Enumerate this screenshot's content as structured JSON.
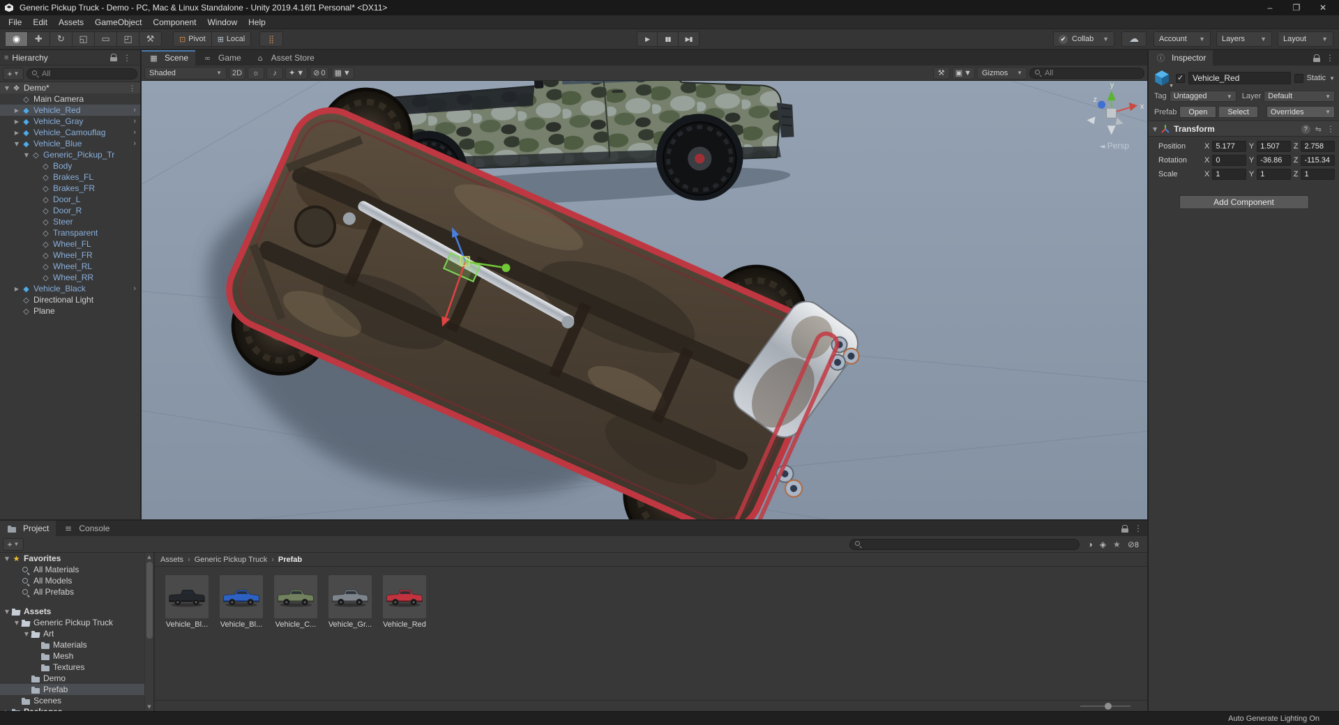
{
  "colors": {
    "prefab_text": "#8ab0dd",
    "prefab_icon": "#4dabea",
    "selection_row": "#4a4d52",
    "scene_background": "#8a98a8",
    "truck_red": "#c2333e",
    "star": "#f5c132",
    "active_tab_accent": "#4c7baf"
  },
  "title_bar": {
    "title": "Generic Pickup Truck - Demo - PC, Mac & Linux Standalone - Unity 2019.4.16f1 Personal* <DX11>",
    "minimize_glyph": "–",
    "maximize_glyph": "❐",
    "close_glyph": "✕"
  },
  "menu_bar": {
    "items": [
      {
        "label": "File"
      },
      {
        "label": "Edit"
      },
      {
        "label": "Assets"
      },
      {
        "label": "GameObject"
      },
      {
        "label": "Component"
      },
      {
        "label": "Window"
      },
      {
        "label": "Help"
      }
    ]
  },
  "toolbar": {
    "tools": [
      {
        "name": "hand-tool-button",
        "glyph": "◉",
        "cls": "active"
      },
      {
        "name": "move-tool-button",
        "glyph": "✚"
      },
      {
        "name": "rotate-tool-button",
        "glyph": "↻"
      },
      {
        "name": "scale-tool-button",
        "glyph": "◱"
      },
      {
        "name": "rect-tool-button",
        "glyph": "▭"
      },
      {
        "name": "transform-tool-button",
        "glyph": "◰"
      },
      {
        "name": "custom-tools-button",
        "glyph": "⚒"
      }
    ],
    "pivot_label": "Pivot",
    "local_label": "Local",
    "pivot_glyph": "⊡",
    "local_glyph": "⊞",
    "grid_snap_glyph": "⣿",
    "play_glyph": "▶",
    "pause_glyph": "▮▮",
    "step_glyph": "▶▮",
    "collab_label": "Collab",
    "collab_check_glyph": "✔",
    "cloud_glyph": "☁",
    "account_label": "Account",
    "layers_label": "Layers",
    "layout_label": "Layout"
  },
  "hierarchy": {
    "title": "Hierarchy",
    "search_placeholder": "All",
    "items": [
      {
        "label": "Demo*",
        "depth": 0,
        "icon": "icon-unity",
        "cls": "scene-row",
        "expander": "▼",
        "trail": "⋮"
      },
      {
        "label": "Main Camera",
        "depth": 1,
        "icon": "icon-go"
      },
      {
        "label": "Vehicle_Red",
        "depth": 1,
        "icon": "icon-prefab",
        "cls": "blue selected",
        "expander": "▶",
        "trail": "›"
      },
      {
        "label": "Vehicle_Gray",
        "depth": 1,
        "icon": "icon-prefab",
        "cls": "blue",
        "expander": "▶",
        "trail": "›"
      },
      {
        "label": "Vehicle_Camouflag",
        "depth": 1,
        "icon": "icon-prefab",
        "cls": "blue",
        "expander": "▶",
        "trail": "›"
      },
      {
        "label": "Vehicle_Blue",
        "depth": 1,
        "icon": "icon-prefab",
        "cls": "blue",
        "expander": "▼",
        "trail": "›"
      },
      {
        "label": "Generic_Pickup_Tr",
        "depth": 2,
        "icon": "icon-go",
        "cls": "blue",
        "expander": "▼"
      },
      {
        "label": "Body",
        "depth": 3,
        "icon": "icon-go",
        "cls": "blue"
      },
      {
        "label": "Brakes_FL",
        "depth": 3,
        "icon": "icon-go",
        "cls": "blue"
      },
      {
        "label": "Brakes_FR",
        "depth": 3,
        "icon": "icon-go",
        "cls": "blue"
      },
      {
        "label": "Door_L",
        "depth": 3,
        "icon": "icon-go",
        "cls": "blue"
      },
      {
        "label": "Door_R",
        "depth": 3,
        "icon": "icon-go",
        "cls": "blue"
      },
      {
        "label": "Steer",
        "depth": 3,
        "icon": "icon-go",
        "cls": "blue"
      },
      {
        "label": "Transparent",
        "depth": 3,
        "icon": "icon-go",
        "cls": "blue"
      },
      {
        "label": "Wheel_FL",
        "depth": 3,
        "icon": "icon-go",
        "cls": "blue"
      },
      {
        "label": "Wheel_FR",
        "depth": 3,
        "icon": "icon-go",
        "cls": "blue"
      },
      {
        "label": "Wheel_RL",
        "depth": 3,
        "icon": "icon-go",
        "cls": "blue"
      },
      {
        "label": "Wheel_RR",
        "depth": 3,
        "icon": "icon-go",
        "cls": "blue"
      },
      {
        "label": "Vehicle_Black",
        "depth": 1,
        "icon": "icon-prefab",
        "cls": "blue",
        "expander": "▶",
        "trail": "›"
      },
      {
        "label": "Directional Light",
        "depth": 1,
        "icon": "icon-go"
      },
      {
        "label": "Plane",
        "depth": 1,
        "icon": "icon-go"
      }
    ]
  },
  "scene_view": {
    "tabs": [
      {
        "label": "Scene",
        "icon": "▦",
        "cls": "active blue-top"
      },
      {
        "label": "Game",
        "icon": "∞",
        "cls": ""
      },
      {
        "label": "Asset Store",
        "icon": "⌂",
        "cls": ""
      }
    ],
    "shading_mode": "Shaded",
    "toggle_2d_label": "2D",
    "light_glyph": "☼",
    "audio_glyph": "♪",
    "fx_glyph": "✦",
    "hidden_glyph": "⊘",
    "hidden_count": "0",
    "grid_glyph": "▦",
    "tools_glyph": "⚒",
    "camera_glyph": "▣",
    "gizmos_label": "Gizmos",
    "search_placeholder": "All",
    "axis_x": "x",
    "axis_y": "y",
    "axis_z": "z",
    "projection_label": "Persp"
  },
  "inspector": {
    "tab_label": "Inspector",
    "object_name": "Vehicle_Red",
    "static_label": "Static",
    "tag_label": "Tag",
    "tag_value": "Untagged",
    "layer_label": "Layer",
    "layer_value": "Default",
    "prefab_label": "Prefab",
    "open_label": "Open",
    "select_label": "Select",
    "overrides_label": "Overrides",
    "transform": {
      "title": "Transform",
      "axis_x": "X",
      "axis_y": "Y",
      "axis_z": "Z",
      "rows": [
        {
          "label": "Position",
          "x": "5.177",
          "y": "1.507",
          "z": "2.758"
        },
        {
          "label": "Rotation",
          "x": "0",
          "y": "-36.86",
          "z": "-115.34"
        },
        {
          "label": "Scale",
          "x": "1",
          "y": "1",
          "z": "1"
        }
      ]
    },
    "add_component_label": "Add Component"
  },
  "project": {
    "tabs": [
      {
        "label": "Project",
        "icon": "icon-folder",
        "cls": "active"
      },
      {
        "label": "Console",
        "icon": "icon-console",
        "cls": ""
      }
    ],
    "search_placeholder": "",
    "type_filter_glyph": "◑",
    "label_filter_glyph": "◈",
    "favorite_glyph": "★",
    "hidden_glyph": "⊘",
    "hidden_count": "8",
    "tree": [
      {
        "label": "Favorites",
        "depth": 0,
        "icon": "icon-star",
        "cls": "bold",
        "expander": "▼"
      },
      {
        "label": "All Materials",
        "depth": 1,
        "icon": "icon-search-item"
      },
      {
        "label": "All Models",
        "depth": 1,
        "icon": "icon-search-item"
      },
      {
        "label": "All Prefabs",
        "depth": 1,
        "icon": "icon-search-item"
      },
      {
        "label": "Assets",
        "depth": 0,
        "icon": "icon-folder-open",
        "cls": "bold gap",
        "expander": "▼"
      },
      {
        "label": "Generic Pickup Truck",
        "depth": 1,
        "icon": "icon-folder-open",
        "expander": "▼"
      },
      {
        "label": "Art",
        "depth": 2,
        "icon": "icon-folder-open",
        "expander": "▼"
      },
      {
        "label": "Materials",
        "depth": 3,
        "icon": "icon-folder"
      },
      {
        "label": "Mesh",
        "depth": 3,
        "icon": "icon-folder"
      },
      {
        "label": "Textures",
        "depth": 3,
        "icon": "icon-folder"
      },
      {
        "label": "Demo",
        "depth": 2,
        "icon": "icon-folder"
      },
      {
        "label": "Prefab",
        "depth": 2,
        "icon": "icon-folder",
        "cls": "selected"
      },
      {
        "label": "Scenes",
        "depth": 1,
        "icon": "icon-folder"
      },
      {
        "label": "Packages",
        "depth": 0,
        "icon": "icon-folder",
        "cls": "bold",
        "expander": "▶"
      }
    ],
    "breadcrumb": [
      {
        "label": "Assets",
        "cls": ""
      },
      {
        "label": "Generic Pickup Truck",
        "cls": ""
      },
      {
        "label": "Prefab",
        "cls": "current"
      }
    ],
    "assets": [
      {
        "label": "Vehicle_Bl...",
        "color": "#23262b"
      },
      {
        "label": "Vehicle_Bl...",
        "color": "#2d62c4"
      },
      {
        "label": "Vehicle_C...",
        "color": "#72825f"
      },
      {
        "label": "Vehicle_Gr...",
        "color": "#7d848c"
      },
      {
        "label": "Vehicle_Red",
        "color": "#c2333e"
      }
    ]
  },
  "status_bar": {
    "message": "Auto Generate Lighting On"
  }
}
